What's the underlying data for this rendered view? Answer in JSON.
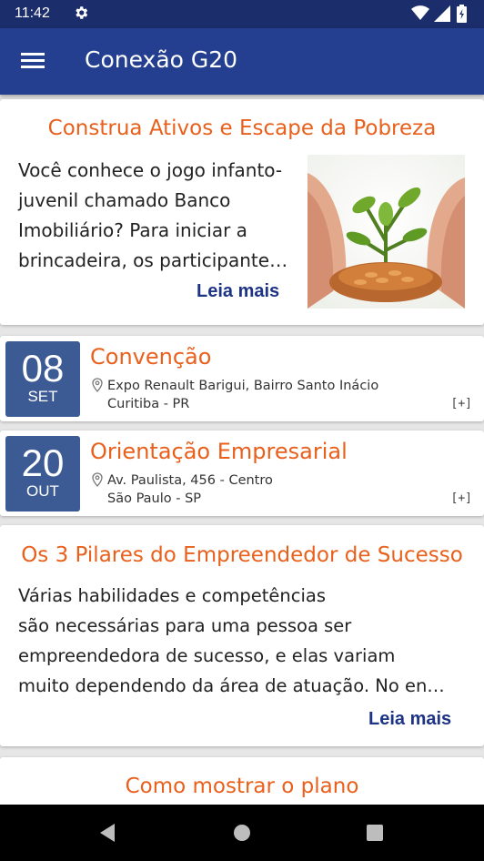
{
  "status_bar": {
    "time": "11:42"
  },
  "app_bar": {
    "title": "Conexão G20"
  },
  "articles": [
    {
      "title": "Construa Ativos e Escape da Pobreza",
      "lines": [
        "Você conhece o jogo infanto-",
        "juvenil chamado Banco",
        "Imobiliário? Para iniciar a",
        "brincadeira, os participante…"
      ],
      "read_more": "Leia mais"
    },
    {
      "title": "Os 3 Pilares do Empreendedor de Sucesso",
      "lines": [
        "Várias habilidades e competências",
        "são necessárias para uma pessoa ser",
        "empreendedora de sucesso, e elas variam",
        "muito dependendo da área de atuação. No en…"
      ],
      "read_more": "Leia mais"
    },
    {
      "title": "Como mostrar o plano"
    }
  ],
  "events": [
    {
      "day": "08",
      "month": "SET",
      "title": "Convenção",
      "address_line1": "Expo Renault Barigui, Bairro Santo Inácio",
      "address_line2": "Curitiba - PR",
      "expand": "[+]"
    },
    {
      "day": "20",
      "month": "OUT",
      "title": "Orientação Empresarial",
      "address_line1": "Av. Paulista, 456 - Centro",
      "address_line2": "São Paulo - SP",
      "expand": "[+]"
    }
  ],
  "colors": {
    "app_bar": "#243f8f",
    "status_bar": "#1b2d6b",
    "accent_orange": "#e8601c",
    "link_blue": "#1d3384",
    "date_box": "#3c5a93"
  }
}
